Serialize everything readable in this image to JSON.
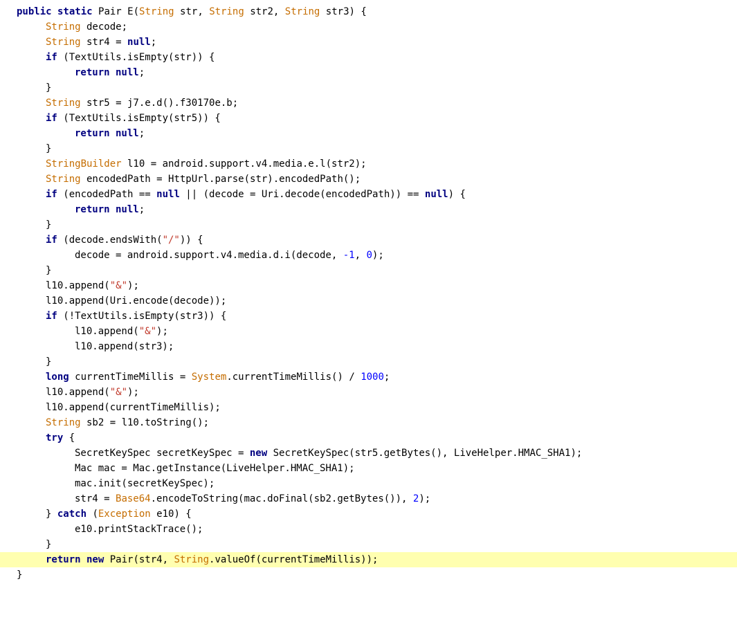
{
  "colors": {
    "background": "#ffffff",
    "keyword": "#000080",
    "string": "#c0392b",
    "number": "#0000ff",
    "type": "#c56d00",
    "highlight": "#ffffb0"
  },
  "editor": {
    "highlighted_line_index": 38,
    "lines": [
      {
        "indent": 0,
        "tokens": [
          [
            "kw",
            "public static "
          ],
          [
            "plain",
            "Pair E("
          ],
          [
            "typ",
            "String"
          ],
          [
            "plain",
            " str, "
          ],
          [
            "typ",
            "String"
          ],
          [
            "plain",
            " str2, "
          ],
          [
            "typ",
            "String"
          ],
          [
            "plain",
            " str3) {"
          ]
        ]
      },
      {
        "indent": 1,
        "tokens": [
          [
            "typ",
            "String"
          ],
          [
            "plain",
            " decode;"
          ]
        ]
      },
      {
        "indent": 1,
        "tokens": [
          [
            "typ",
            "String"
          ],
          [
            "plain",
            " str4 = "
          ],
          [
            "kw",
            "null"
          ],
          [
            "plain",
            ";"
          ]
        ]
      },
      {
        "indent": 1,
        "tokens": [
          [
            "kw",
            "if"
          ],
          [
            "plain",
            " (TextUtils.isEmpty(str)) {"
          ]
        ]
      },
      {
        "indent": 2,
        "tokens": [
          [
            "kw",
            "return null"
          ],
          [
            "plain",
            ";"
          ]
        ]
      },
      {
        "indent": 1,
        "tokens": [
          [
            "plain",
            "}"
          ]
        ]
      },
      {
        "indent": 1,
        "tokens": [
          [
            "typ",
            "String"
          ],
          [
            "plain",
            " str5 = j7.e.d().f30170e.b;"
          ]
        ]
      },
      {
        "indent": 1,
        "tokens": [
          [
            "kw",
            "if"
          ],
          [
            "plain",
            " (TextUtils.isEmpty(str5)) {"
          ]
        ]
      },
      {
        "indent": 2,
        "tokens": [
          [
            "kw",
            "return null"
          ],
          [
            "plain",
            ";"
          ]
        ]
      },
      {
        "indent": 1,
        "tokens": [
          [
            "plain",
            "}"
          ]
        ]
      },
      {
        "indent": 1,
        "tokens": [
          [
            "typ",
            "StringBuilder"
          ],
          [
            "plain",
            " l10 = android.support.v4.media.e.l(str2);"
          ]
        ]
      },
      {
        "indent": 1,
        "tokens": [
          [
            "typ",
            "String"
          ],
          [
            "plain",
            " encodedPath = HttpUrl.parse(str).encodedPath();"
          ]
        ]
      },
      {
        "indent": 1,
        "tokens": [
          [
            "kw",
            "if"
          ],
          [
            "plain",
            " (encodedPath == "
          ],
          [
            "kw",
            "null"
          ],
          [
            "plain",
            " || (decode = Uri.decode(encodedPath)) == "
          ],
          [
            "kw",
            "null"
          ],
          [
            "plain",
            ") {"
          ]
        ]
      },
      {
        "indent": 2,
        "tokens": [
          [
            "kw",
            "return null"
          ],
          [
            "plain",
            ";"
          ]
        ]
      },
      {
        "indent": 1,
        "tokens": [
          [
            "plain",
            "}"
          ]
        ]
      },
      {
        "indent": 1,
        "tokens": [
          [
            "kw",
            "if"
          ],
          [
            "plain",
            " (decode.endsWith("
          ],
          [
            "str",
            "\"/\""
          ],
          [
            "plain",
            ")) {"
          ]
        ]
      },
      {
        "indent": 2,
        "tokens": [
          [
            "plain",
            "decode = android.support.v4.media.d.i(decode, "
          ],
          [
            "num",
            "-1"
          ],
          [
            "plain",
            ", "
          ],
          [
            "num",
            "0"
          ],
          [
            "plain",
            ");"
          ]
        ]
      },
      {
        "indent": 1,
        "tokens": [
          [
            "plain",
            "}"
          ]
        ]
      },
      {
        "indent": 1,
        "tokens": [
          [
            "plain",
            "l10.append("
          ],
          [
            "str",
            "\"&\""
          ],
          [
            "plain",
            ");"
          ]
        ]
      },
      {
        "indent": 1,
        "tokens": [
          [
            "plain",
            "l10.append(Uri.encode(decode));"
          ]
        ]
      },
      {
        "indent": 1,
        "tokens": [
          [
            "kw",
            "if"
          ],
          [
            "plain",
            " (!TextUtils.isEmpty(str3)) {"
          ]
        ]
      },
      {
        "indent": 2,
        "tokens": [
          [
            "plain",
            "l10.append("
          ],
          [
            "str",
            "\"&\""
          ],
          [
            "plain",
            ");"
          ]
        ]
      },
      {
        "indent": 2,
        "tokens": [
          [
            "plain",
            "l10.append(str3);"
          ]
        ]
      },
      {
        "indent": 1,
        "tokens": [
          [
            "plain",
            "}"
          ]
        ]
      },
      {
        "indent": 1,
        "tokens": [
          [
            "kw",
            "long"
          ],
          [
            "plain",
            " currentTimeMillis = "
          ],
          [
            "typ",
            "System"
          ],
          [
            "plain",
            ".currentTimeMillis() / "
          ],
          [
            "num",
            "1000"
          ],
          [
            "plain",
            ";"
          ]
        ]
      },
      {
        "indent": 1,
        "tokens": [
          [
            "plain",
            "l10.append("
          ],
          [
            "str",
            "\"&\""
          ],
          [
            "plain",
            ");"
          ]
        ]
      },
      {
        "indent": 1,
        "tokens": [
          [
            "plain",
            "l10.append(currentTimeMillis);"
          ]
        ]
      },
      {
        "indent": 1,
        "tokens": [
          [
            "typ",
            "String"
          ],
          [
            "plain",
            " sb2 = l10.toString();"
          ]
        ]
      },
      {
        "indent": 1,
        "tokens": [
          [
            "kw",
            "try"
          ],
          [
            "plain",
            " {"
          ]
        ]
      },
      {
        "indent": 2,
        "tokens": [
          [
            "plain",
            "SecretKeySpec secretKeySpec = "
          ],
          [
            "kw",
            "new"
          ],
          [
            "plain",
            " SecretKeySpec(str5.getBytes(), LiveHelper.HMAC_SHA1);"
          ]
        ]
      },
      {
        "indent": 2,
        "tokens": [
          [
            "plain",
            "Mac mac = Mac.getInstance(LiveHelper.HMAC_SHA1);"
          ]
        ]
      },
      {
        "indent": 2,
        "tokens": [
          [
            "plain",
            "mac.init(secretKeySpec);"
          ]
        ]
      },
      {
        "indent": 2,
        "tokens": [
          [
            "plain",
            "str4 = "
          ],
          [
            "typ",
            "Base64"
          ],
          [
            "plain",
            ".encodeToString(mac.doFinal(sb2.getBytes()), "
          ],
          [
            "num",
            "2"
          ],
          [
            "plain",
            ");"
          ]
        ]
      },
      {
        "indent": 1,
        "tokens": [
          [
            "plain",
            "} "
          ],
          [
            "kw",
            "catch"
          ],
          [
            "plain",
            " ("
          ],
          [
            "typ",
            "Exception"
          ],
          [
            "plain",
            " e10) {"
          ]
        ]
      },
      {
        "indent": 2,
        "tokens": [
          [
            "plain",
            "e10.printStackTrace();"
          ]
        ]
      },
      {
        "indent": 1,
        "tokens": [
          [
            "plain",
            "}"
          ]
        ]
      },
      {
        "indent": 1,
        "tokens": [
          [
            "kw",
            "return new"
          ],
          [
            "plain",
            " Pair(str4, "
          ],
          [
            "typ",
            "String"
          ],
          [
            "plain",
            ".valueOf(currentTimeMillis));"
          ]
        ]
      },
      {
        "indent": 0,
        "tokens": [
          [
            "plain",
            "}"
          ]
        ]
      }
    ]
  }
}
